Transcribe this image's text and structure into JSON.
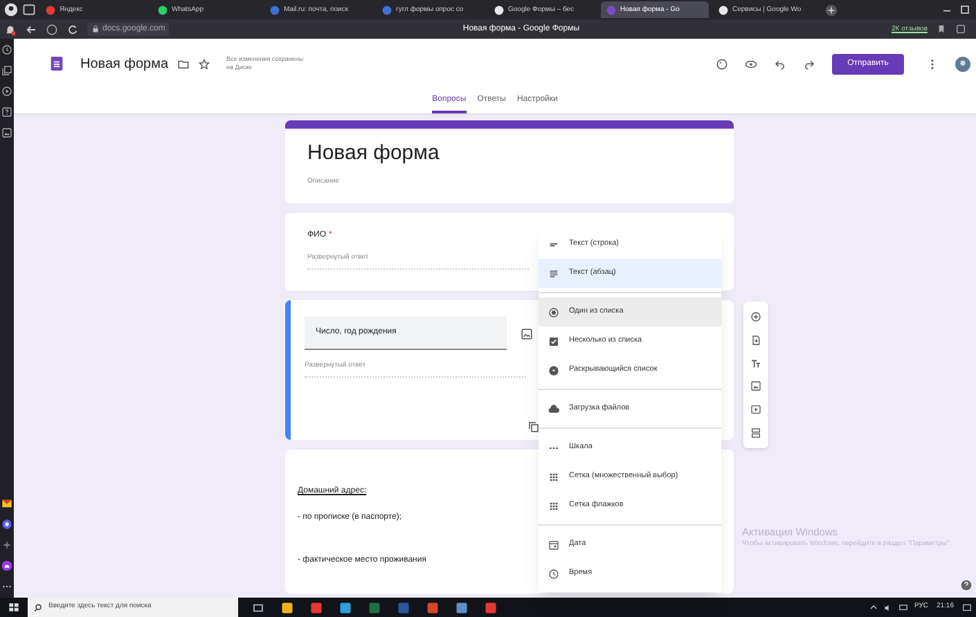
{
  "browser": {
    "tabs": [
      {
        "label": "Яндекс",
        "selected": false
      },
      {
        "label": "WhatsApp",
        "selected": false
      },
      {
        "label": "Mail.ru: почта, поиск",
        "selected": false
      },
      {
        "label": "гугл формы опрос со",
        "selected": false
      },
      {
        "label": "Google Формы – бес",
        "selected": false
      },
      {
        "label": "Новая форма - Go",
        "selected": true
      },
      {
        "label": "Сервисы | Google Wo",
        "selected": false
      }
    ],
    "address": "docs.google.com",
    "page_title": "Новая форма - Google Формы",
    "reviews": "2К отзывов"
  },
  "header": {
    "doc_title": "Новая форма",
    "save_status": "Все изменения сохранены на Диске",
    "send_button": "Отправить",
    "tabs": [
      {
        "label": "Вопросы",
        "selected": true
      },
      {
        "label": "Ответы",
        "selected": false
      },
      {
        "label": "Настройки",
        "selected": false
      }
    ]
  },
  "form": {
    "title": "Новая форма",
    "description": "Описание",
    "question": {
      "title": "ФИО",
      "required_mark": "*",
      "placeholder": "Развернутый ответ"
    },
    "active_question": {
      "title": "Число, год рождения",
      "placeholder": "Развернутый ответ"
    },
    "text_block": [
      {
        "text": "Домашний адрес:",
        "underlined": true
      },
      {
        "text": "- по прописке (в паспорте);",
        "underlined": false
      },
      {
        "text": "- фактическое место проживания",
        "underlined": false
      }
    ]
  },
  "type_menu": [
    [
      {
        "kind": "short",
        "label": "Текст (строка)",
        "selected": false,
        "hovered": false
      },
      {
        "kind": "paragraph",
        "label": "Текст (абзац)",
        "selected": true,
        "hovered": false
      }
    ],
    [
      {
        "kind": "radio",
        "label": "Один из списка",
        "selected": false,
        "hovered": true
      },
      {
        "kind": "checkbox",
        "label": "Несколько из списка",
        "selected": false,
        "hovered": false
      },
      {
        "kind": "dropdown",
        "label": "Раскрывающийся список",
        "selected": false,
        "hovered": false
      }
    ],
    [
      {
        "kind": "upload",
        "label": "Загрузка файлов",
        "selected": false,
        "hovered": false
      }
    ],
    [
      {
        "kind": "scale",
        "label": "Шкала",
        "selected": false,
        "hovered": false
      },
      {
        "kind": "grid",
        "label": "Сетка (множественный выбор)",
        "selected": false,
        "hovered": false
      },
      {
        "kind": "grid",
        "label": "Сетка флажков",
        "selected": false,
        "hovered": false
      }
    ],
    [
      {
        "kind": "date",
        "label": "Дата",
        "selected": false,
        "hovered": false
      },
      {
        "kind": "time",
        "label": "Время",
        "selected": false,
        "hovered": false
      }
    ]
  ],
  "activation": {
    "title": "Активация Windows",
    "text": "Чтобы активировать Windows, перейдите в раздел \"Параметры\"."
  },
  "taskbar": {
    "search_placeholder": "Введите здесь текст для поиска",
    "language": "РУС",
    "time": "21:16"
  }
}
